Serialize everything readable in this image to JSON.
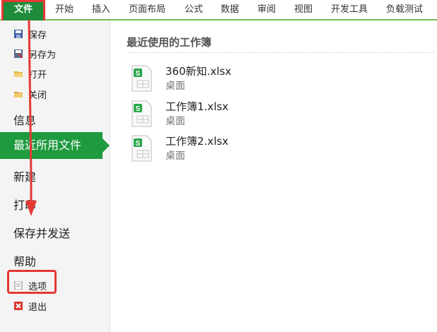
{
  "ribbon": {
    "tabs": [
      "文件",
      "开始",
      "插入",
      "页面布局",
      "公式",
      "数据",
      "审阅",
      "视图",
      "开发工具",
      "负载测试"
    ]
  },
  "nav": {
    "commands": [
      {
        "label": "保存",
        "icon": "save-icon"
      },
      {
        "label": "另存为",
        "icon": "save-as-icon"
      },
      {
        "label": "打开",
        "icon": "open-folder-icon"
      },
      {
        "label": "关闭",
        "icon": "close-folder-icon"
      }
    ],
    "info": "信息",
    "recent": "最近所用文件",
    "new": "新建",
    "print": "打印",
    "save_send": "保存并发送",
    "help": "帮助",
    "options": "选项",
    "exit": "退出"
  },
  "main": {
    "title": "最近使用的工作簿",
    "files": [
      {
        "name": "360新知.xlsx",
        "location": "桌面"
      },
      {
        "name": "工作簿1.xlsx",
        "location": "桌面"
      },
      {
        "name": "工作簿2.xlsx",
        "location": "桌面"
      }
    ]
  },
  "colors": {
    "accent": "#1e9a3f",
    "highlight": "#e53935"
  }
}
